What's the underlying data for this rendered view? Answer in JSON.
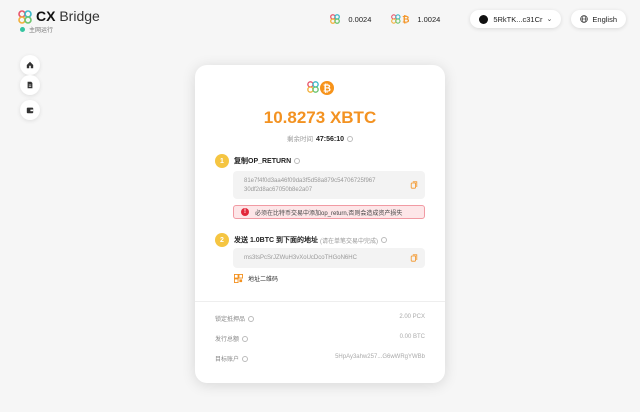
{
  "app": {
    "name_bold": "CX",
    "name_rest": " Bridge",
    "status": "主网运行"
  },
  "topbar": {
    "balance_cx": "0.0024",
    "balance_xbtc": "1.0024",
    "wallet": "5RkTK...c31Cr",
    "language": "English"
  },
  "sidebar": {
    "items": [
      "home-icon",
      "document-icon",
      "wallet-icon"
    ]
  },
  "card": {
    "amount": "10.8273 XBTC",
    "deadline_label": "剩余时间",
    "deadline_value": "47:56:10",
    "step1": {
      "num": "1",
      "title": "复制OP_RETURN",
      "value_line1": "81e7f4f0d3aa46f09da3f5d58a879c54706725f967",
      "value_line2": "30df2d8ac67050b8e2a07",
      "warning": "必须在比特币交易中添加op_return,否则会造成资产损失"
    },
    "step2": {
      "num": "2",
      "title": "发送 1.0BTC 到下面的地址",
      "note": "(请在单笔交易中完成)",
      "address": "ms3tsPcSrJZWuH3vXoUcDcoTHGoN6HC",
      "qr_label": "地址二维码"
    },
    "details": [
      {
        "label": "锁定抵押品",
        "value": "2.00 PCX"
      },
      {
        "label": "发行总额",
        "value": "0.00 BTC"
      },
      {
        "label": "目标账户",
        "value": "5HpAy3ahw257...G6wWRgYWBb"
      }
    ]
  },
  "colors": {
    "accent": "#f39221",
    "step": "#f5c542",
    "warning": "#e2283b",
    "status": "#34c4a0"
  }
}
